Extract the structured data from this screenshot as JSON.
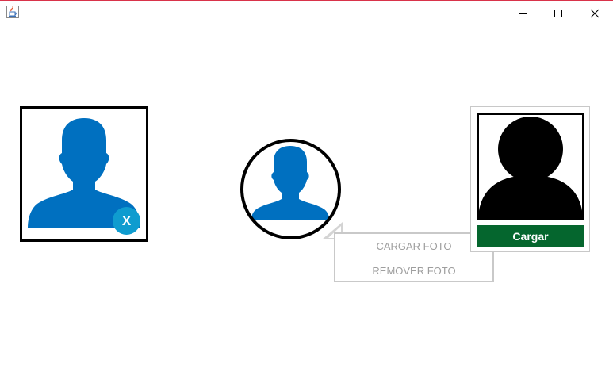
{
  "window": {
    "title": "",
    "icon": "java-cup-icon",
    "controls": [
      "minimize-icon",
      "maximize-icon",
      "close-icon"
    ]
  },
  "avatar_square": {
    "icon": "user-silhouette-icon",
    "badge_label": "X",
    "badge_color": "#0f9ccf",
    "silhouette_color": "#0070c0"
  },
  "avatar_circle": {
    "icon": "user-silhouette-icon",
    "silhouette_color": "#0070c0"
  },
  "popup_menu": {
    "items": [
      "CARGAR FOTO",
      "REMOVER FOTO"
    ]
  },
  "photo_card": {
    "icon": "user-silhouette-icon",
    "silhouette_color": "#000000",
    "button_label": "Cargar",
    "button_color": "#05662e"
  }
}
